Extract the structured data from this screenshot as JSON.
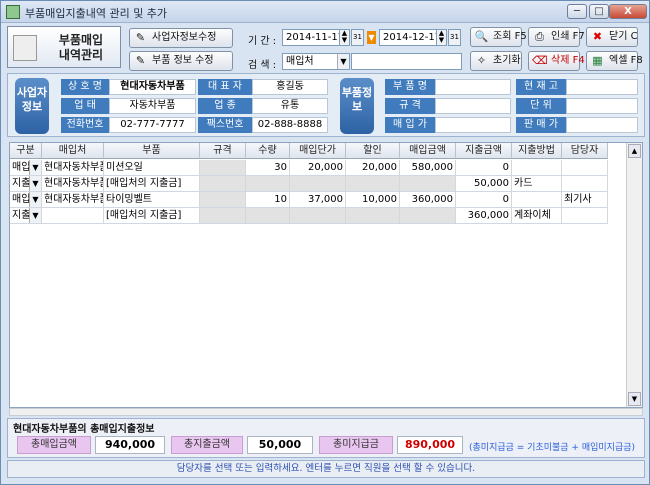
{
  "window": {
    "title": "부품매입지출내역 관리 및 추가",
    "min": "─",
    "max": "□",
    "close": "X"
  },
  "logo": {
    "line1": "부품매입",
    "line2": "내역관리"
  },
  "toolbar": {
    "supplier_edit": "사업자정보수정",
    "part_edit": "부품 정보 수정",
    "period_label": "기 간 :",
    "date_from": "2014-11-17",
    "date_to": "2014-12-17",
    "search_label": "검 색 :",
    "search_field": "매입처",
    "search_value": "",
    "query": "조회 F5",
    "print": "인쇄 F7",
    "close": "닫기 C",
    "reset": "초기화",
    "delete": "삭제 F4",
    "excel": "엑셀 F8"
  },
  "supplier": {
    "side_label": "사업자정보",
    "name_label": "상 호 명",
    "name": "현대자동차부품",
    "rep_label": "대 표 자",
    "rep": "홍길동",
    "type_label": "업 태",
    "type": "자동차부품",
    "item_label": "업 종",
    "item": "유통",
    "phone_label": "전화번호",
    "phone": "02-777-7777",
    "fax_label": "팩스번호",
    "fax": "02-888-8888"
  },
  "part": {
    "side_label": "부품정보",
    "name_label": "부 품 명",
    "name": "",
    "stock_label": "현 재 고",
    "stock": "",
    "spec_label": "규 격",
    "spec": "",
    "unit_label": "단 위",
    "unit": "",
    "buy_label": "매 입 가",
    "buy": "",
    "sell_label": "판 매 가",
    "sell": ""
  },
  "grid": {
    "headers": [
      "구분",
      "매입처",
      "부품",
      "규격",
      "수량",
      "매입단가",
      "할인",
      "매입금액",
      "지출금액",
      "지출방법",
      "담당자"
    ],
    "rows": [
      [
        "매입",
        "현대자동차부품",
        "미션오일",
        "",
        "30",
        "20,000",
        "20,000",
        "580,000",
        "0",
        "",
        ""
      ],
      [
        "지출",
        "현대자동차부품",
        "[매입처의 지출금]",
        "",
        "",
        "",
        "",
        "",
        "50,000",
        "카드",
        ""
      ],
      [
        "매입",
        "현대자동차부품",
        "타이밍벨트",
        "",
        "10",
        "37,000",
        "10,000",
        "360,000",
        "0",
        "",
        "최기사"
      ],
      [
        "지출",
        "",
        "[매입처의 지출금]",
        "",
        "",
        "",
        "",
        "",
        "360,000",
        "계좌이체",
        ""
      ]
    ]
  },
  "summary": {
    "title": "현대자동차부품의 총매입지출정보",
    "total_buy_label": "총매입금액",
    "total_buy": "940,000",
    "total_pay_label": "총지출금액",
    "total_pay": "50,000",
    "total_unpaid_label": "총미지급금",
    "total_unpaid": "890,000",
    "note": "(총미지급금 = 기초미불금 + 매입미지급금)"
  },
  "status": "담당자를 선택 또는 입력하세요. 엔터를 누르면 직원을 선택 할 수 있습니다.",
  "colors": {
    "accent_blue": "#3f7bbd",
    "pink": "#e9c6f0",
    "unpaid_red": "#d00000"
  }
}
